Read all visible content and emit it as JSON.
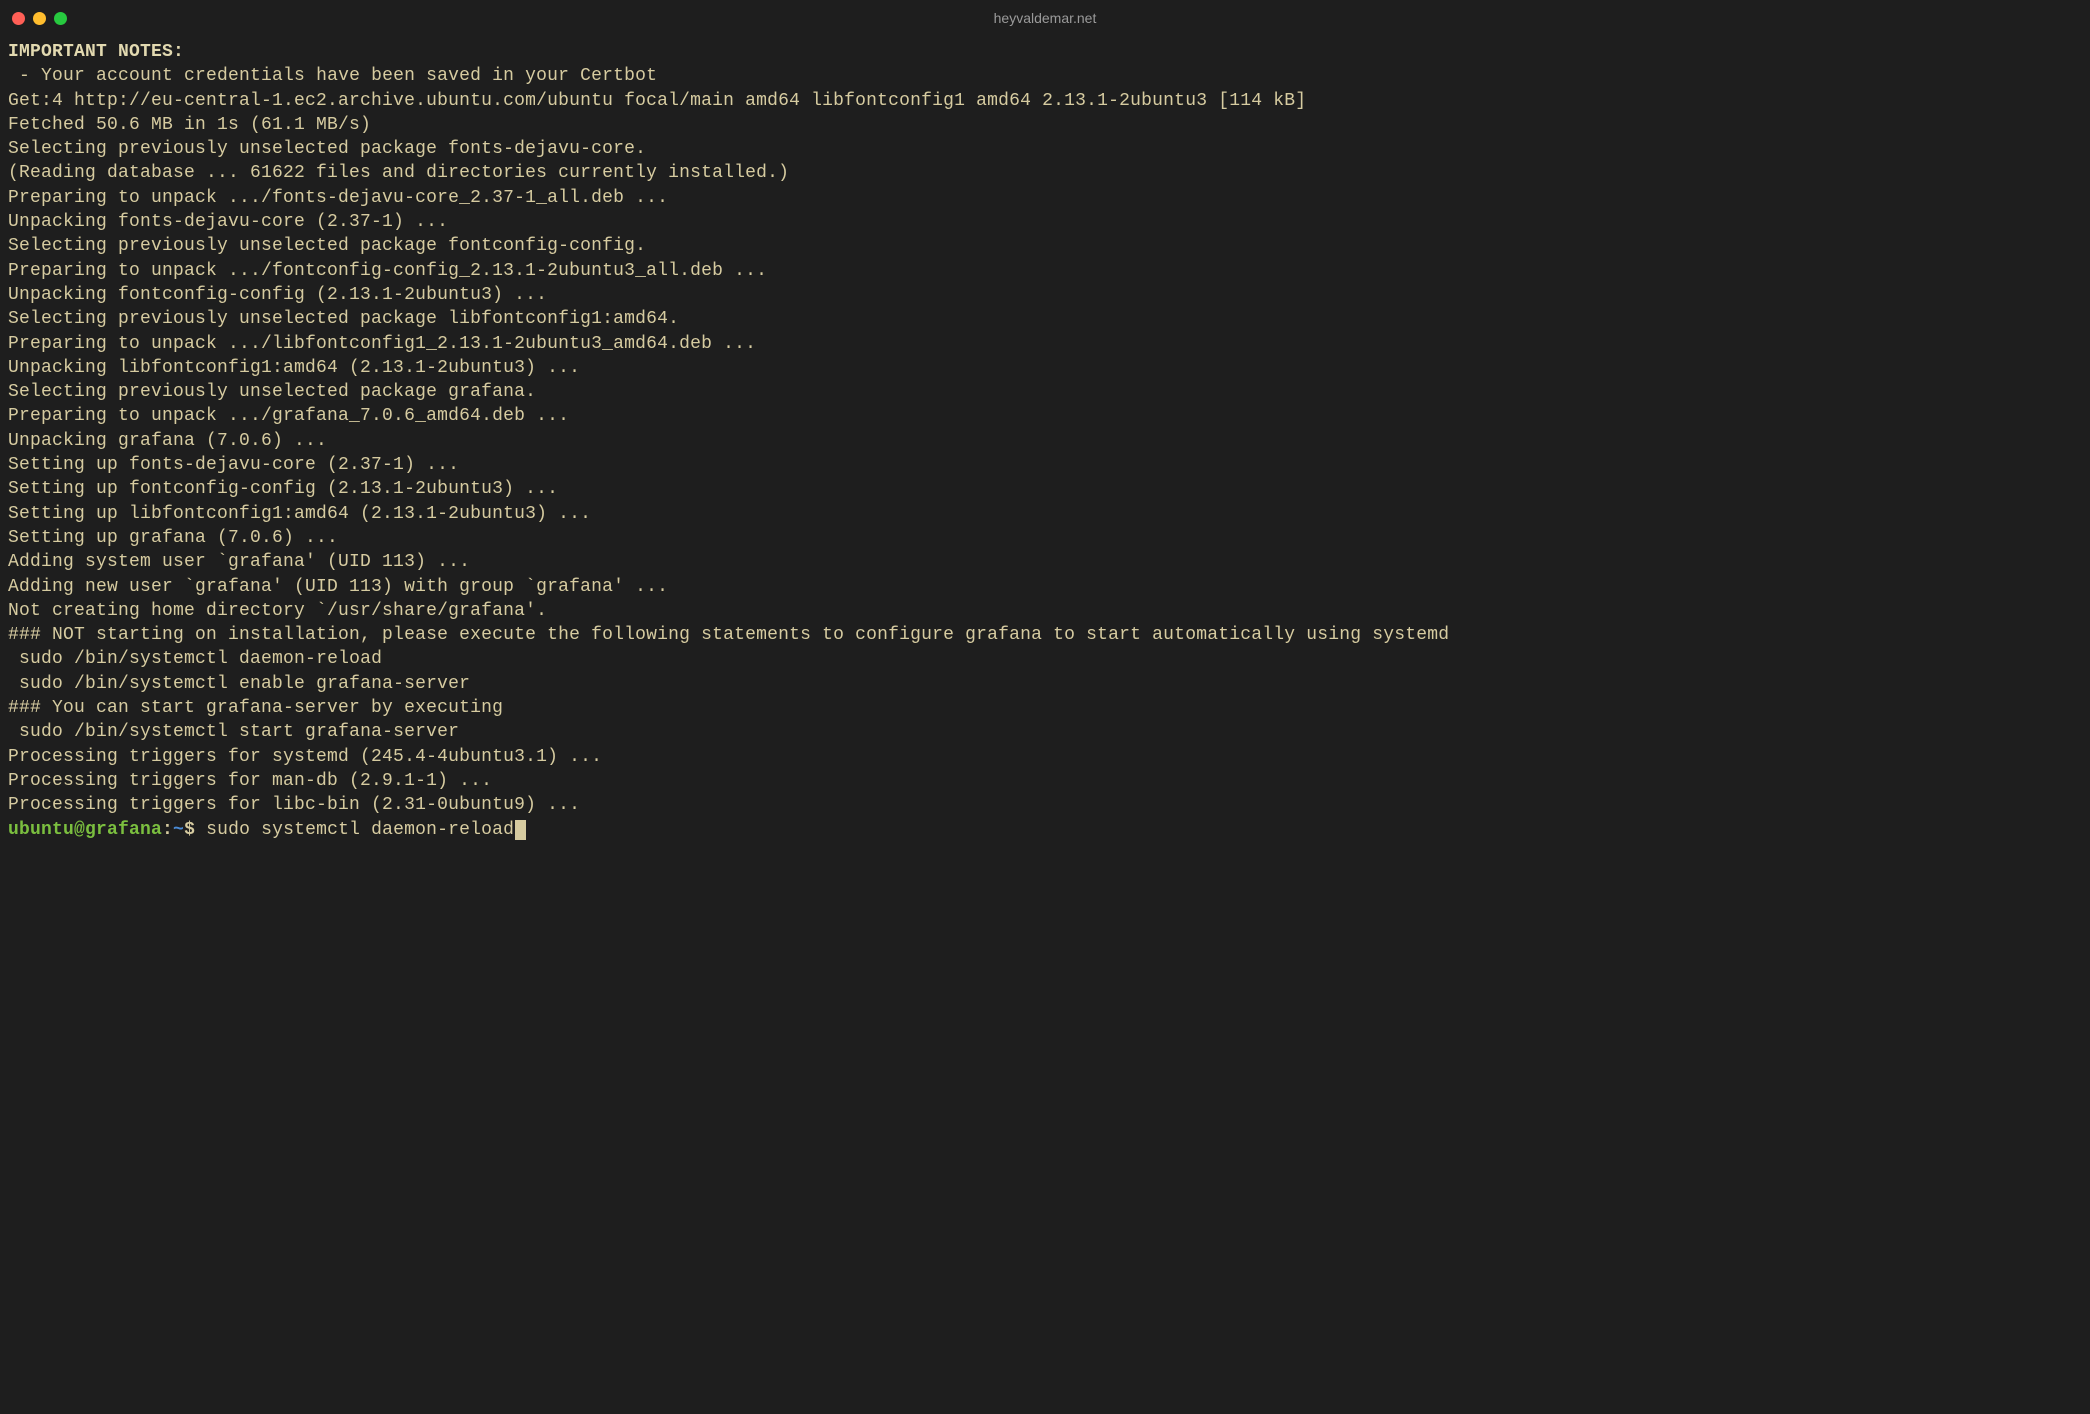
{
  "window": {
    "title": "heyvaldemar.net"
  },
  "output": {
    "heading": "IMPORTANT NOTES:",
    "lines": [
      " - Your account credentials have been saved in your Certbot",
      "Get:4 http://eu-central-1.ec2.archive.ubuntu.com/ubuntu focal/main amd64 libfontconfig1 amd64 2.13.1-2ubuntu3 [114 kB]",
      "Fetched 50.6 MB in 1s (61.1 MB/s)",
      "Selecting previously unselected package fonts-dejavu-core.",
      "(Reading database ... 61622 files and directories currently installed.)",
      "Preparing to unpack .../fonts-dejavu-core_2.37-1_all.deb ...",
      "Unpacking fonts-dejavu-core (2.37-1) ...",
      "Selecting previously unselected package fontconfig-config.",
      "Preparing to unpack .../fontconfig-config_2.13.1-2ubuntu3_all.deb ...",
      "Unpacking fontconfig-config (2.13.1-2ubuntu3) ...",
      "Selecting previously unselected package libfontconfig1:amd64.",
      "Preparing to unpack .../libfontconfig1_2.13.1-2ubuntu3_amd64.deb ...",
      "Unpacking libfontconfig1:amd64 (2.13.1-2ubuntu3) ...",
      "Selecting previously unselected package grafana.",
      "Preparing to unpack .../grafana_7.0.6_amd64.deb ...",
      "Unpacking grafana (7.0.6) ...",
      "Setting up fonts-dejavu-core (2.37-1) ...",
      "Setting up fontconfig-config (2.13.1-2ubuntu3) ...",
      "Setting up libfontconfig1:amd64 (2.13.1-2ubuntu3) ...",
      "Setting up grafana (7.0.6) ...",
      "Adding system user `grafana' (UID 113) ...",
      "Adding new user `grafana' (UID 113) with group `grafana' ...",
      "Not creating home directory `/usr/share/grafana'.",
      "### NOT starting on installation, please execute the following statements to configure grafana to start automatically using systemd",
      " sudo /bin/systemctl daemon-reload",
      " sudo /bin/systemctl enable grafana-server",
      "### You can start grafana-server by executing",
      " sudo /bin/systemctl start grafana-server",
      "Processing triggers for systemd (245.4-4ubuntu3.1) ...",
      "Processing triggers for man-db (2.9.1-1) ...",
      "Processing triggers for libc-bin (2.31-0ubuntu9) ..."
    ]
  },
  "prompt": {
    "user_host": "ubuntu@grafana",
    "separator": ":",
    "path": "~",
    "symbol": "$",
    "command": "sudo systemctl daemon-reload"
  }
}
